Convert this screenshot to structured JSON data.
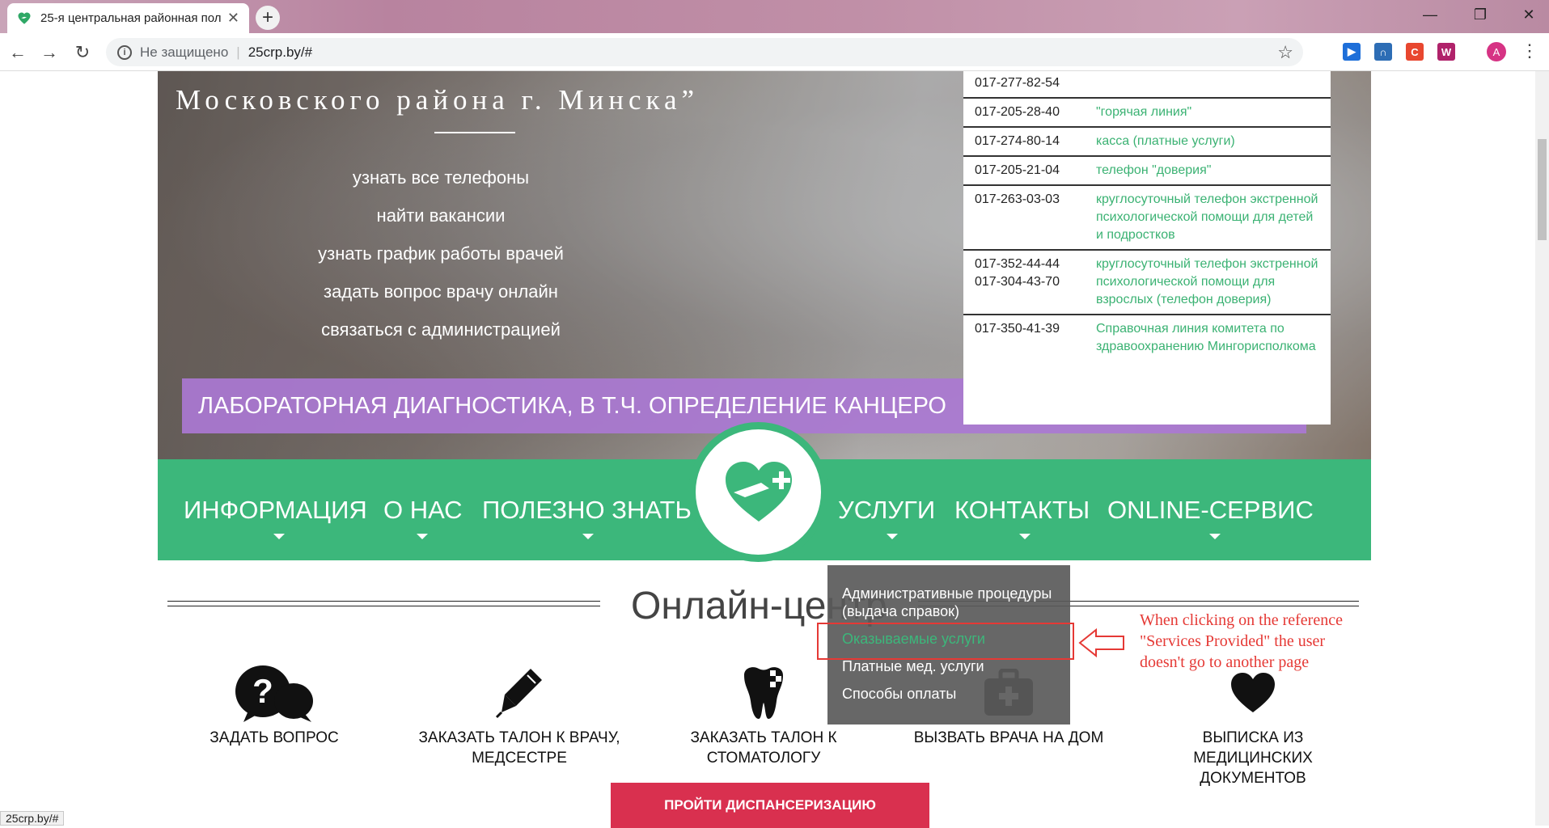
{
  "browser": {
    "tab_title": "25-я центральная районная пол",
    "insecure_label": "Не защищено",
    "url": "25crp.by/#",
    "avatar_letter": "A",
    "status_url": "25crp.by/#"
  },
  "hero": {
    "title": "Московского района г. Минска”",
    "links": [
      "узнать все телефоны",
      "найти вакансии",
      "узнать график работы врачей",
      "задать вопрос врачу онлайн",
      "связаться с администрацией"
    ],
    "ticker": "ЛАБОРАТОРНАЯ ДИАГНОСТИКА, В Т.Ч. ОПРЕДЕЛЕНИЕ КАНЦЕРО"
  },
  "phones": [
    {
      "number": "017-277-82-54",
      "desc": ""
    },
    {
      "number": "017-205-28-40",
      "desc": "\"горячая линия\""
    },
    {
      "number": "017-274-80-14",
      "desc": "касса (платные услуги)"
    },
    {
      "number": "017-205-21-04",
      "desc": "телефон \"доверия\""
    },
    {
      "number": "017-263-03-03",
      "desc": "круглосуточный телефон экстренной психологической помощи для детей и подростков"
    },
    {
      "number": "017-352-44-44\n017-304-43-70",
      "desc": "круглосуточный телефон экстренной психологической помощи для взрослых (телефон доверия)"
    },
    {
      "number": "017-350-41-39",
      "desc": "Справочная линия комитета по здравоохранению Мингорисполкома"
    }
  ],
  "nav": {
    "items": [
      "ИНФОРМАЦИЯ",
      "О НАС",
      "ПОЛЕЗНО ЗНАТЬ",
      "УСЛУГИ",
      "КОНТАКТЫ",
      "ONLINE-СЕРВИС"
    ]
  },
  "dropdown": {
    "items": [
      "Административные процедуры (выдача справок)",
      "Оказываемые услуги",
      "Платные мед. услуги",
      "Способы оплаты"
    ]
  },
  "annotation": {
    "text": " When clicking on the reference\n\"Services Provided\" the user\ndoesn't go to another page"
  },
  "online_center": {
    "title": "Онлайн-центр",
    "services": [
      {
        "label": "ЗАДАТЬ ВОПРОС",
        "icon": "question-chat-icon"
      },
      {
        "label": "ЗАКАЗАТЬ ТАЛОН К ВРАЧУ, МЕДСЕСТРЕ",
        "icon": "pen-icon"
      },
      {
        "label": "ЗАКАЗАТЬ ТАЛОН К СТОМАТОЛОГУ",
        "icon": "tooth-icon"
      },
      {
        "label": "ВЫЗВАТЬ ВРАЧА НА ДОМ",
        "icon": "medical-bag-icon"
      },
      {
        "label": "ВЫПИСКА ИЗ МЕДИЦИНСКИХ ДОКУМЕНТОВ",
        "icon": "heart-icon"
      }
    ],
    "cta": "ПРОЙТИ ДИСПАНСЕРИЗАЦИЮ"
  },
  "colors": {
    "brand_green": "#3cb77b",
    "ticker_purple": "#aa78d2",
    "cta_red": "#d9304f",
    "annotation_red": "#e53935"
  }
}
